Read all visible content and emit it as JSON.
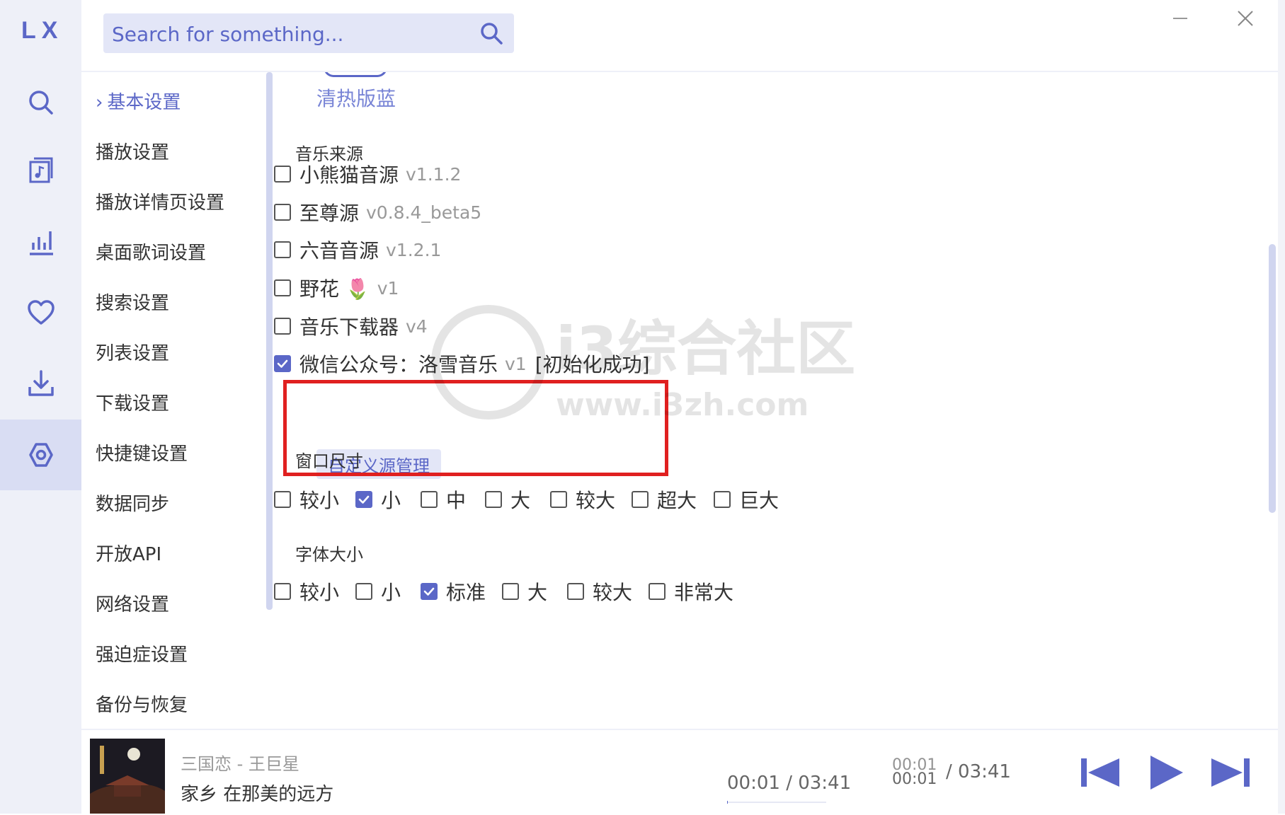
{
  "app": {
    "logo": "LX"
  },
  "search": {
    "placeholder": "Search for something..."
  },
  "rail": [
    {
      "name": "search-nav",
      "icon": "search-icon",
      "active": false
    },
    {
      "name": "songlist-nav",
      "icon": "music-list-icon",
      "active": false
    },
    {
      "name": "leaderboard-nav",
      "icon": "chart-icon",
      "active": false
    },
    {
      "name": "favorites-nav",
      "icon": "heart-icon",
      "active": false
    },
    {
      "name": "download-nav",
      "icon": "download-icon",
      "active": false
    },
    {
      "name": "settings-nav",
      "icon": "settings-icon",
      "active": true
    }
  ],
  "nav": {
    "active_marker": "›",
    "items": [
      "基本设置",
      "播放设置",
      "播放详情页设置",
      "桌面歌词设置",
      "搜索设置",
      "列表设置",
      "下载设置",
      "快捷键设置",
      "数据同步",
      "开放API",
      "网络设置",
      "强迫症设置",
      "备份与恢复"
    ]
  },
  "theme": {
    "name": "清热版蓝"
  },
  "music_source": {
    "title": "音乐来源",
    "sources": [
      {
        "name": "小熊猫音源",
        "version": "v1.1.2",
        "checked": false,
        "status": ""
      },
      {
        "name": "至尊源",
        "version": "v0.8.4_beta5",
        "checked": false,
        "status": ""
      },
      {
        "name": "六音音源",
        "version": "v1.2.1",
        "checked": false,
        "status": ""
      },
      {
        "name": "野花 🌷",
        "version": "v1",
        "checked": false,
        "status": ""
      },
      {
        "name": "音乐下载器",
        "version": "v4",
        "checked": false,
        "status": ""
      },
      {
        "name": "微信公众号：洛雪音乐",
        "version": "v1",
        "checked": true,
        "status": "[初始化成功]"
      }
    ],
    "manage_button": "自定义源管理"
  },
  "window_size": {
    "title": "窗口尺寸",
    "options": [
      {
        "label": "较小",
        "checked": false
      },
      {
        "label": "小",
        "checked": true
      },
      {
        "label": "中",
        "checked": false
      },
      {
        "label": "大",
        "checked": false
      },
      {
        "label": "较大",
        "checked": false
      },
      {
        "label": "超大",
        "checked": false
      },
      {
        "label": "巨大",
        "checked": false
      }
    ]
  },
  "font_size": {
    "title": "字体大小",
    "options": [
      {
        "label": "较小",
        "checked": false
      },
      {
        "label": "小",
        "checked": false
      },
      {
        "label": "标准",
        "checked": true
      },
      {
        "label": "大",
        "checked": false
      },
      {
        "label": "较大",
        "checked": false
      },
      {
        "label": "非常大",
        "checked": false
      }
    ]
  },
  "watermark": {
    "title": "i3综合社区",
    "url": "www.i3zh.com"
  },
  "player": {
    "subtitle": "三国恋 - 王巨星",
    "title": "家乡 在那美的远方",
    "time_a": "00:01 / 03:41",
    "time_b_current": "00:01",
    "time_b_total": "/ 03:41",
    "progress": 0.005
  },
  "colors": {
    "accent": "#5b67c7",
    "highlight_border": "#e02020",
    "rail_bg": "#eef0f8"
  }
}
